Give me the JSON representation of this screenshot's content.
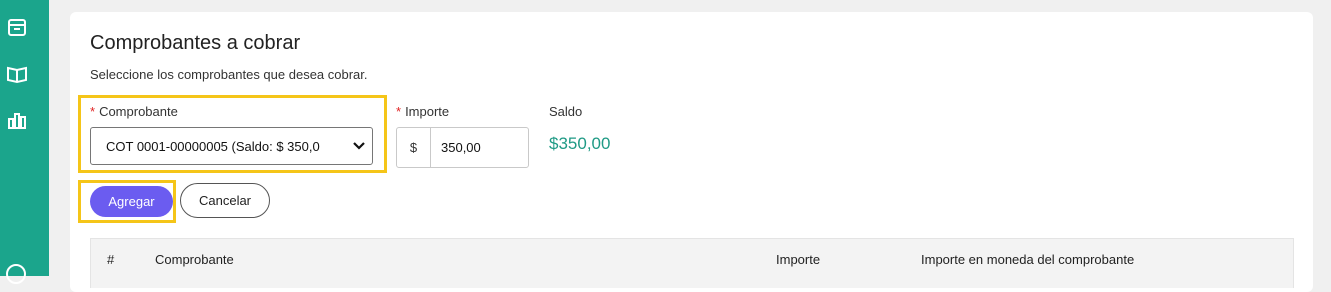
{
  "sidebar": {
    "icons": [
      "box-icon",
      "book-icon",
      "chart-icon",
      "user-icon"
    ]
  },
  "page": {
    "title": "Comprobantes a cobrar",
    "subtitle": "Seleccione los comprobantes que desea cobrar."
  },
  "form": {
    "comprobante_label": "Comprobante",
    "comprobante_value": "COT 0001-00000005 (Saldo: $ 350,0",
    "importe_label": "Importe",
    "currency_prefix": "$",
    "importe_value": "350,00",
    "saldo_label": "Saldo",
    "saldo_value": "$350,00",
    "required_mark": "*"
  },
  "buttons": {
    "add": "Agregar",
    "cancel": "Cancelar"
  },
  "table": {
    "headers": [
      "#",
      "Comprobante",
      "Importe",
      "Importe en moneda del comprobante"
    ]
  },
  "colors": {
    "sidebar": "#1ba58c",
    "primary_button": "#6b5cf0",
    "saldo_text": "#1f9a85",
    "highlight": "#f5c518"
  }
}
